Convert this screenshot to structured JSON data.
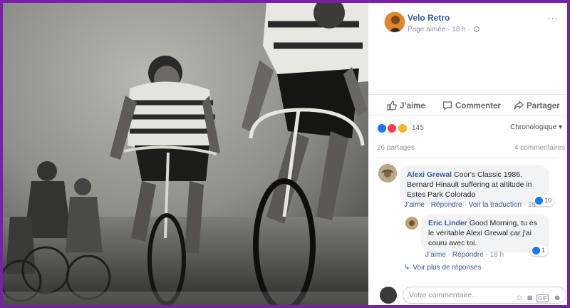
{
  "post": {
    "page_name": "Velo Retro",
    "meta_text": "Page aimée · 18 h ·",
    "more_label": "···"
  },
  "actions": {
    "like": "J’aime",
    "comment": "Commenter",
    "share": "Partager"
  },
  "reactions": {
    "count": "145",
    "sort_label": "Chronologique ▾",
    "colors": [
      "#1877f2",
      "#f33e58",
      "#f7b125"
    ]
  },
  "stats": {
    "shares": "26 partages",
    "comments": "4 commentaires"
  },
  "comments": [
    {
      "author": "Alexi Grewal",
      "text": "Coor's Classic 1986, Bernard Hinault suffering at altitude in Estes Park Colorado",
      "like": "J’aime",
      "reply": "Répondre",
      "translate": "Voir la traduction",
      "time": "18",
      "likes": "10"
    },
    {
      "author": "Eric Linder",
      "text": "Good Morning, tu es le véritable Alexi Grewal car j'ai couru avec toi.",
      "like": "J’aime",
      "reply": "Répondre",
      "time": "18 h",
      "likes": "1"
    }
  ],
  "show_more": "Voir plus de réponses",
  "composer": {
    "placeholder": "Votre commentaire...",
    "icons": [
      "emoji-icon",
      "camera-icon",
      "gif-icon",
      "sticker-icon"
    ]
  }
}
